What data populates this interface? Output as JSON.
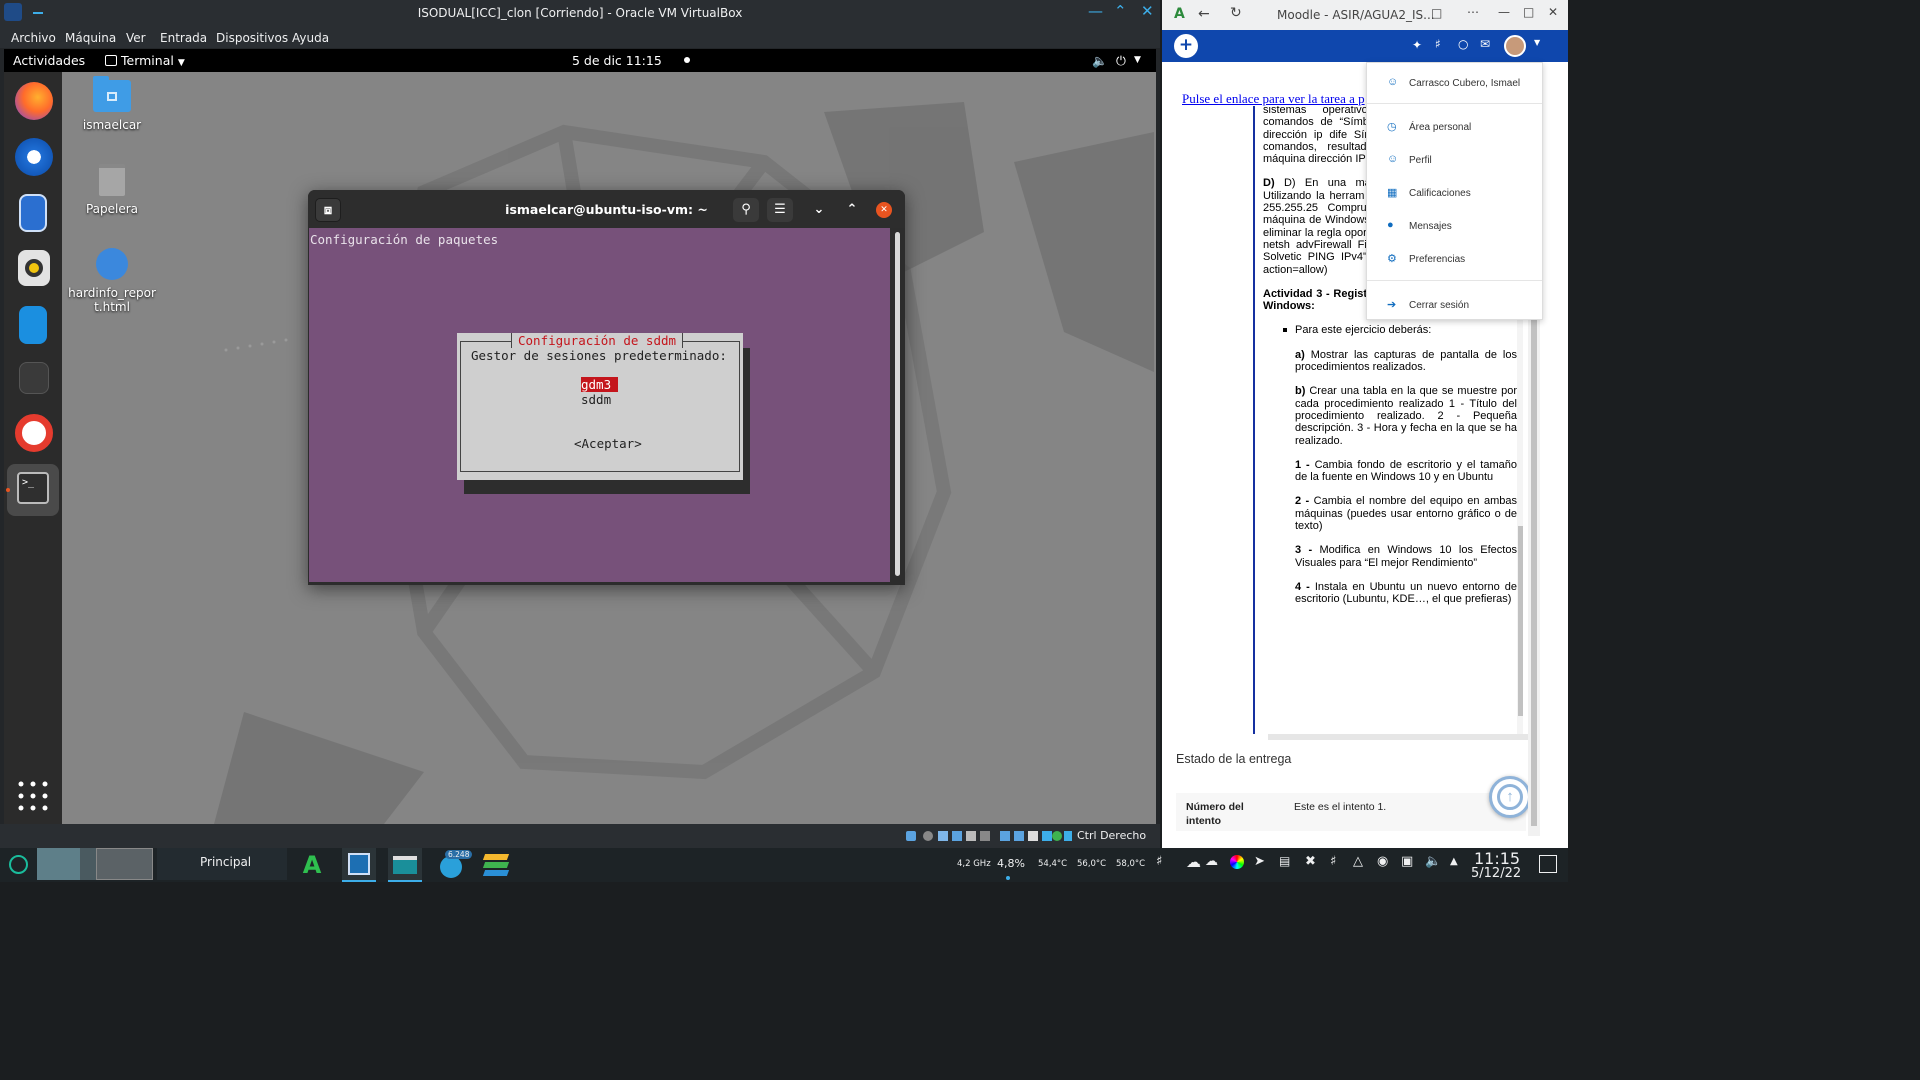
{
  "vbox": {
    "title": "ISODUAL[ICC]_clon [Corriendo] - Oracle VM VirtualBox",
    "menu": [
      "Archivo",
      "Máquina",
      "Ver",
      "Entrada",
      "Dispositivos",
      "Ayuda"
    ],
    "status_host_key": "Ctrl Derecho"
  },
  "gnome": {
    "activities": "Actividades",
    "app_menu": "Terminal",
    "clock": "5 de dic  11:15"
  },
  "desktop": {
    "icons": [
      {
        "label": "ismaelcar",
        "icon": "home-folder-icon"
      },
      {
        "label": "Papelera",
        "icon": "trash-icon"
      },
      {
        "label": "hardinfo_report.html",
        "icon": "html-file-icon"
      }
    ]
  },
  "dock": [
    "firefox-icon",
    "thunderbird-icon",
    "files-icon",
    "rhythmbox-icon",
    "writer-icon",
    "software-updater-icon",
    "help-icon",
    "terminal-icon",
    "show-apps-icon"
  ],
  "terminal": {
    "title": "ismaelcar@ubuntu-iso-vm: ~",
    "header_line": "Configuración de paquetes",
    "dialog": {
      "title": "Configuración de sddm",
      "prompt": "Gestor de sesiones predeterminado:",
      "options": [
        "gdm3",
        "sddm"
      ],
      "selected": "gdm3",
      "ok": "<Aceptar>"
    }
  },
  "browser": {
    "title": "Moodle - ASIR/AGUA2_IS...",
    "link": "Pulse el enlace para ver la tarea a p",
    "user_menu": {
      "name": "Carrasco Cubero, Ismael",
      "items": [
        "Área personal",
        "Perfil",
        "Calificaciones",
        "Mensajes",
        "Preferencias",
        "Cerrar sesión"
      ]
    },
    "text_blocks": [
      "sistemas operativos netplan). En Window comandos de “Símbo comandos por defect una dirección ip dife Símbolo de Sistema) utilizando comandos, resultado. Comprueb entre ambas máquina dirección IP con en W",
      "D) En una máquina interfaz de red con Utilizando la herram interfaz de red la di máscara 255.255.25 Comprueba la config ping con la máquina de Windows 10. Es posible que necesites eliminar la regla oportuna en el FireWall (Comando: netsh advFirewall Firewall add rule name=\"Regla Solvetic PING IPv4\" protocol=icmpv4:8,any dir=in action=allow)"
    ],
    "activity3_title": "Actividad 3 - Registro y variables de entorno en Windows:",
    "bullet": "Para este ejercicio deberás:",
    "sub_a_label": "a)",
    "sub_a": "Mostrar las capturas de pantalla de los procedimientos realizados.",
    "sub_b_label": "b)",
    "sub_b": "Crear una tabla en la que se muestre por cada procedimiento realizado 1 - Título del procedimiento realizado. 2 - Pequeña descripción. 3 - Hora y fecha en la que se ha realizado.",
    "tasks": [
      {
        "n": "1 -",
        "t": "Cambia fondo de escritorio y el tamaño de la fuente en Windows 10 y en Ubuntu"
      },
      {
        "n": "2 -",
        "t": "Cambia el nombre del equipo en ambas máquinas (puedes usar entorno gráfico o de texto)"
      },
      {
        "n": "3 -",
        "t": "Modifica en Windows 10 los Efectos Visuales para “El mejor Rendimiento”"
      },
      {
        "n": "4 -",
        "t": "Instala en Ubuntu un nuevo entorno de escritorio (Lubuntu, KDE…, el que prefieras)"
      }
    ],
    "estado": "Estado de la entrega",
    "intento_label": "Número del intento",
    "intento_value": "Este es el intento 1."
  },
  "taskbar": {
    "desktop_label": "Principal",
    "badge": "6.248",
    "stats": [
      "4,2 GHz",
      "4,8%",
      "54,4°C",
      "56,0°C",
      "58,0°C"
    ],
    "time": "11:15",
    "date": "5/12/22"
  },
  "colors": {
    "terminal_bg": "#77517a",
    "moodle_nav": "#0f47ad",
    "dialog_selected": "#c4151c",
    "dialog_title": "#c4151c"
  }
}
